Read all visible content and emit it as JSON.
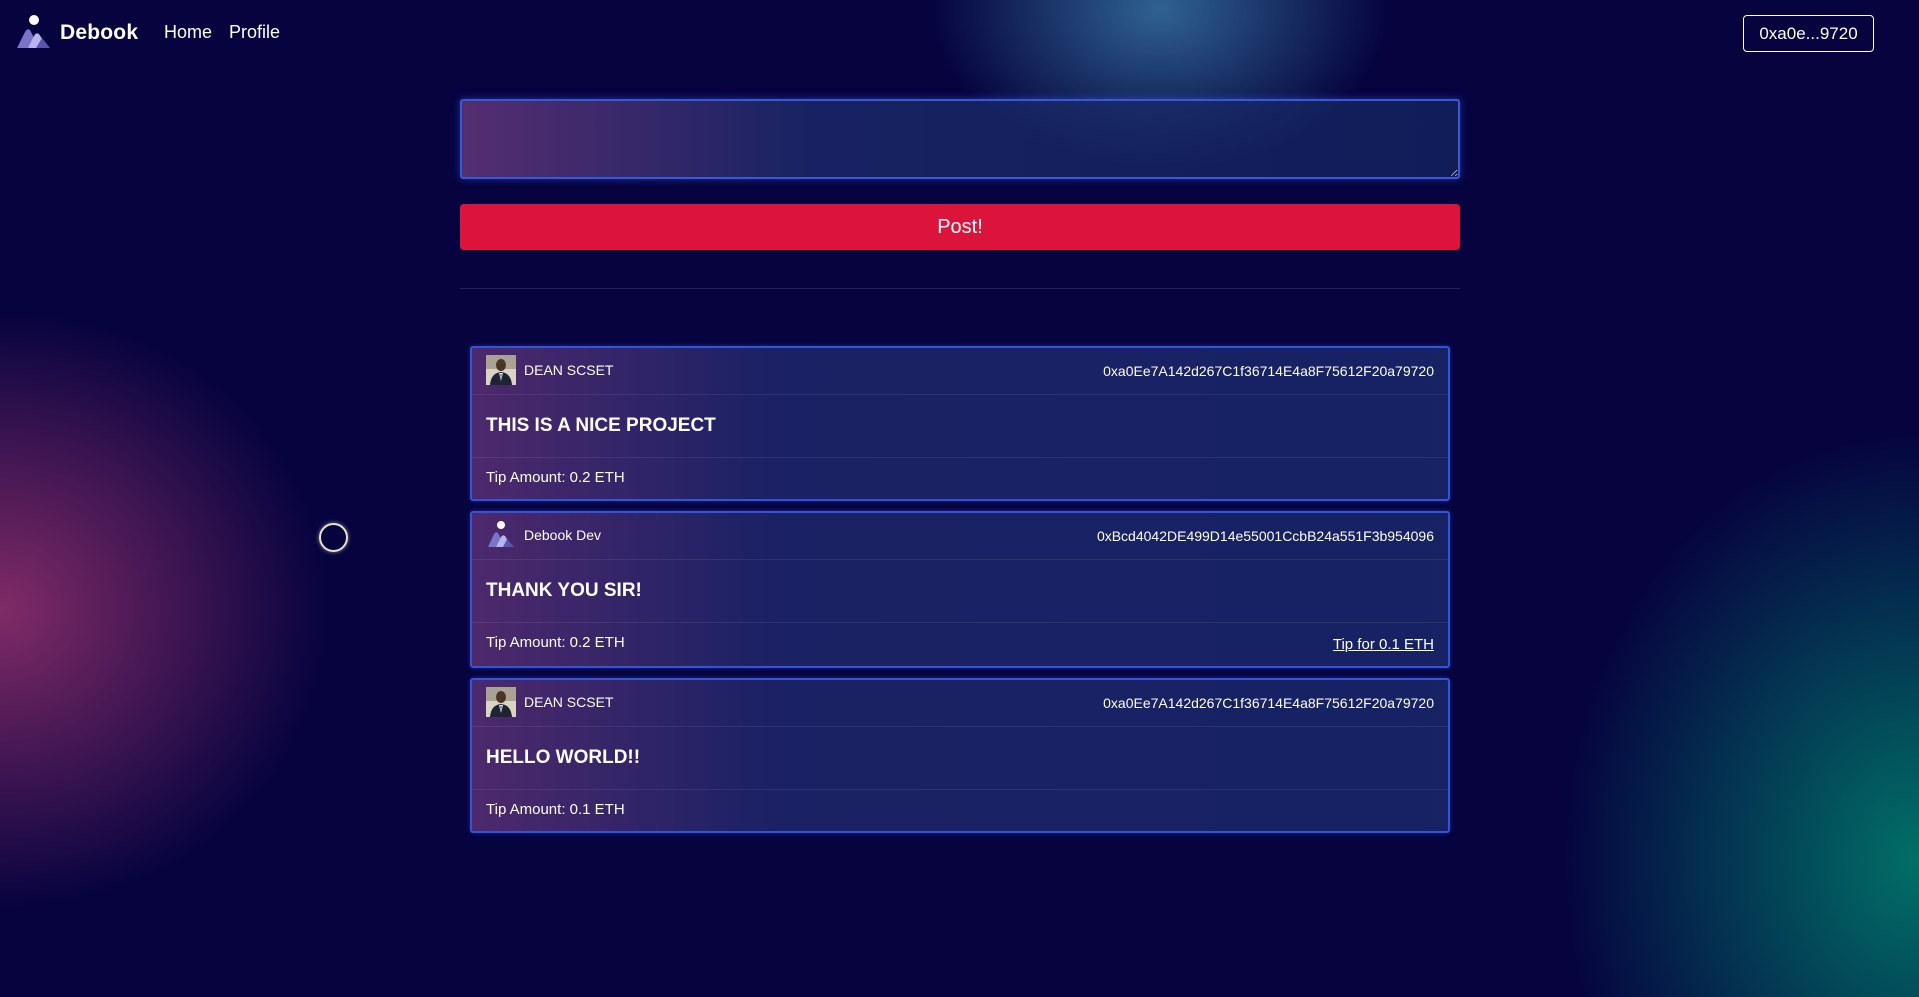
{
  "header": {
    "brand_name": "Debook",
    "nav": [
      {
        "label": "Home"
      },
      {
        "label": "Profile"
      }
    ],
    "wallet_label": "0xa0e...9720"
  },
  "composer": {
    "placeholder": "",
    "value": "",
    "post_label": "Post!"
  },
  "posts": [
    {
      "author": "DEAN SCSET",
      "avatar": "person-photo",
      "address": "0xa0Ee7A142d267C1f36714E4a8F75612F20a79720",
      "text": "THIS IS A NICE PROJECT",
      "tip_amount": "Tip Amount: 0.2 ETH",
      "tip_action": ""
    },
    {
      "author": "Debook Dev",
      "avatar": "debook-logo",
      "address": "0xBcd4042DE499D14e55001CcbB24a551F3b954096",
      "text": "THANK YOU SIR!",
      "tip_amount": "Tip Amount: 0.2 ETH",
      "tip_action": "Tip for 0.1 ETH"
    },
    {
      "author": "DEAN SCSET",
      "avatar": "person-photo",
      "address": "0xa0Ee7A142d267C1f36714E4a8F75612F20a79720",
      "text": "HELLO WORLD!!",
      "tip_amount": "Tip Amount: 0.1 ETH",
      "tip_action": ""
    }
  ],
  "colors": {
    "background": "#06033f",
    "accent_border": "#3354d6",
    "post_button": "#dc143c"
  }
}
